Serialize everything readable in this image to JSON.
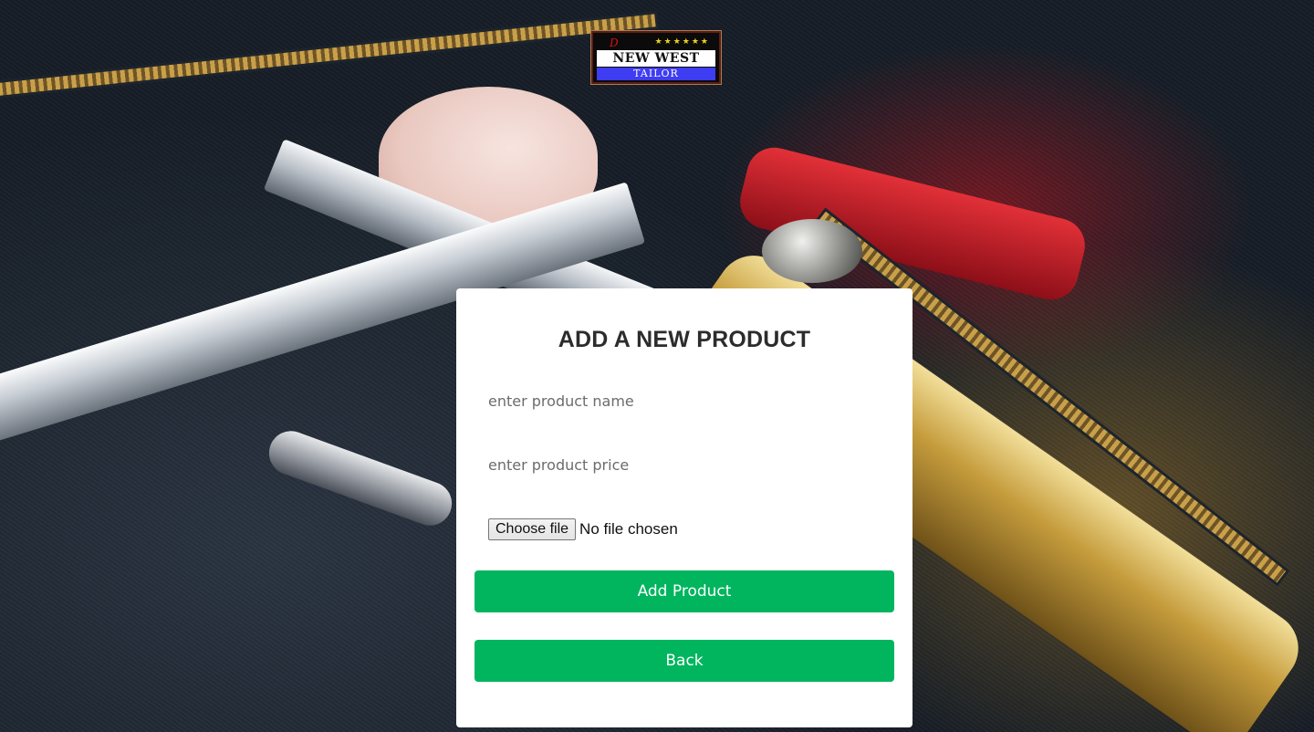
{
  "logo": {
    "mark": "D",
    "stars": "★★★★★★",
    "line1": "NEW WEST",
    "line2": "TAILOR"
  },
  "form": {
    "title": "ADD A NEW PRODUCT",
    "name_placeholder": "enter product name",
    "price_placeholder": "enter product price",
    "file_button_label": "Choose file",
    "file_status": "No file chosen",
    "submit_label": "Add Product",
    "back_label": "Back"
  },
  "colors": {
    "primary_button": "#00b55e",
    "card_background": "#ffffff",
    "title_text": "#2c2c2c"
  }
}
